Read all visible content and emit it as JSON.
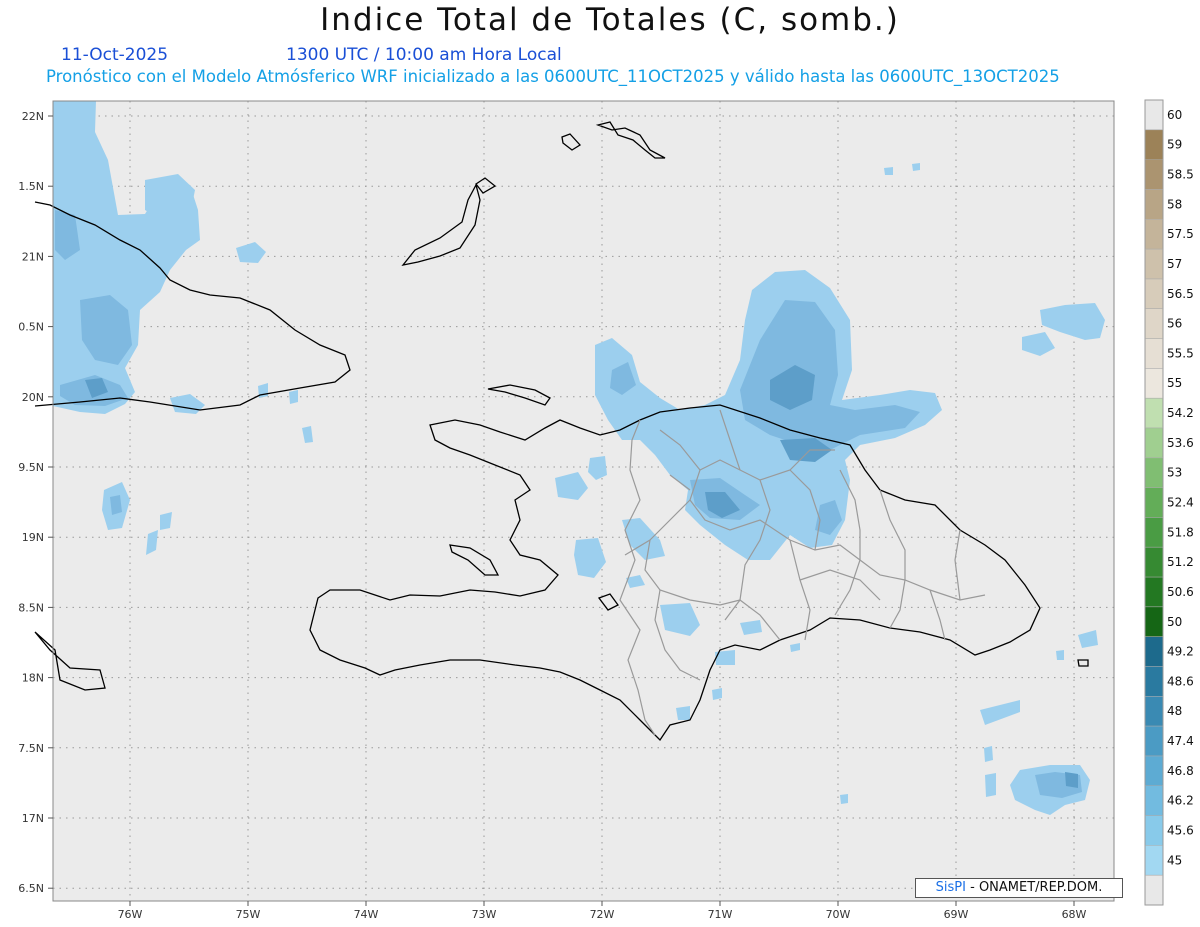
{
  "header": {
    "title": "Indice Total de Totales (C, somb.)",
    "date": "11-Oct-2025",
    "time": "1300 UTC / 10:00 am Hora Local",
    "subtitle": "Pronóstico con el Modelo Atmósferico WRF inicializado a las 0600UTC_11OCT2025 y válido hasta las  0600UTC_13OCT2025"
  },
  "axes": {
    "lon_labels": [
      "76W",
      "75W",
      "74W",
      "73W",
      "72W",
      "71W",
      "70W",
      "69W",
      "68W"
    ],
    "lat_labels": [
      "22N",
      "1.5N",
      "21N",
      "0.5N",
      "20N",
      "9.5N",
      "19N",
      "8.5N",
      "18N",
      "7.5N",
      "17N",
      "6.5N"
    ]
  },
  "colorbar": {
    "labels": [
      "60",
      "59",
      "58.5",
      "58",
      "57.5",
      "57",
      "56.5",
      "56",
      "55.5",
      "55",
      "54.2",
      "53.6",
      "53",
      "52.4",
      "51.8",
      "51.2",
      "50.6",
      "50",
      "49.2",
      "48.6",
      "48",
      "47.4",
      "46.8",
      "46.2",
      "45.6",
      "45"
    ],
    "colors": [
      "#e8e8e8",
      "#9c8258",
      "#ab9470",
      "#b8a586",
      "#c4b49a",
      "#cec1ab",
      "#d7ccba",
      "#dfd6c8",
      "#e6dfd4",
      "#ece7de",
      "#c0dfb0",
      "#a0cf90",
      "#80be72",
      "#63ad58",
      "#4a9c44",
      "#368a32",
      "#237822",
      "#156615",
      "#1d6a8c",
      "#2a7aa0",
      "#3a8ab3",
      "#4b9bc4",
      "#5dabd3",
      "#72bbe0",
      "#88caea",
      "#a2d8f2",
      "#e8e8e8"
    ]
  },
  "map": {
    "background": "#ebebeb",
    "shading_light": "#9ccfee",
    "shading_mid": "#7fb9e0",
    "shading_dark": "#5d9ec9"
  },
  "credit": {
    "brand": "SisPI",
    "org": " - ONAMET/REP.DOM."
  }
}
